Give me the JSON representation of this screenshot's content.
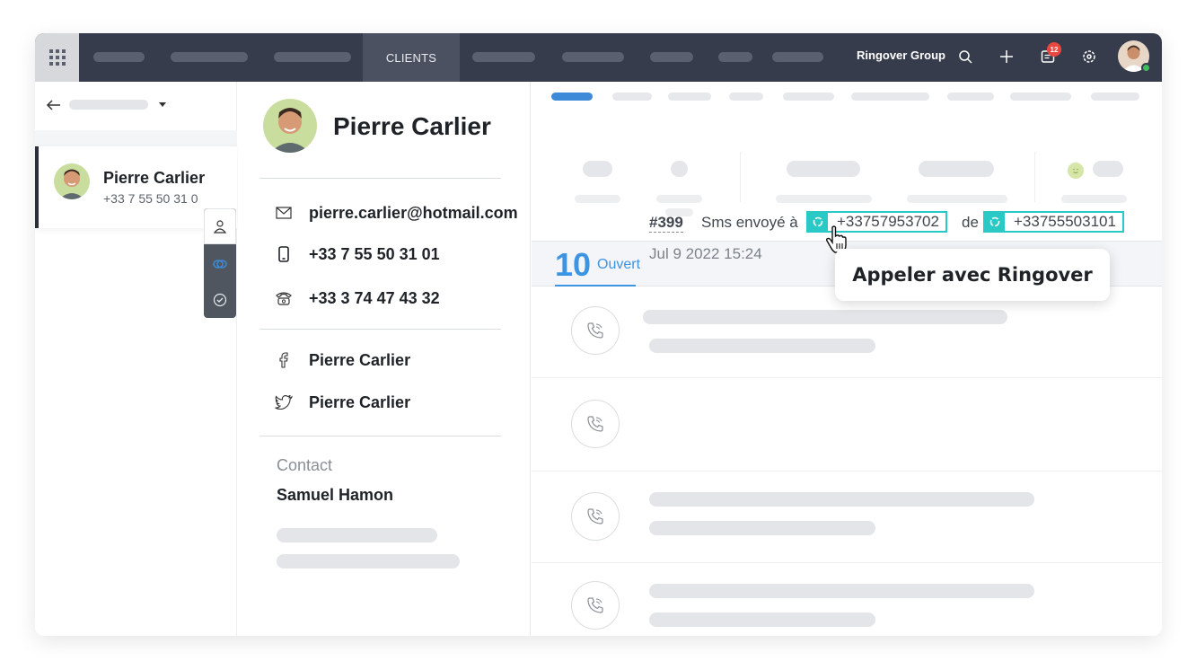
{
  "topbar": {
    "active_tab": "CLIENTS",
    "company": "Ringover Group",
    "notification_count": "12"
  },
  "left_panel": {
    "card": {
      "name": "Pierre Carlier",
      "phone": "+33 7 55 50 31 0"
    }
  },
  "contact": {
    "name": "Pierre Carlier",
    "email": "pierre.carlier@hotmail.com",
    "mobile": "+33 7 55 50 31 01",
    "landline": "+33 3 74 47 43 32",
    "facebook": "Pierre Carlier",
    "twitter": "Pierre Carlier",
    "contact_label": "Contact",
    "contact_owner": "Samuel Hamon"
  },
  "activity": {
    "open_count": "10",
    "open_label": "Ouvert",
    "ticket": {
      "id": "#399",
      "text": "Sms envoyé à",
      "to_number": "+33757953702",
      "from_label": "de",
      "from_number": "+33755503101",
      "date": "Jul 9 2022 15:24"
    },
    "tooltip": "Appeler avec Ringover"
  },
  "colors": {
    "topbar": "#363c4c",
    "accent_blue": "#3d94e2",
    "teal": "#2bc9c6",
    "badge_red": "#e8483f",
    "online_green": "#3ebd5d"
  }
}
